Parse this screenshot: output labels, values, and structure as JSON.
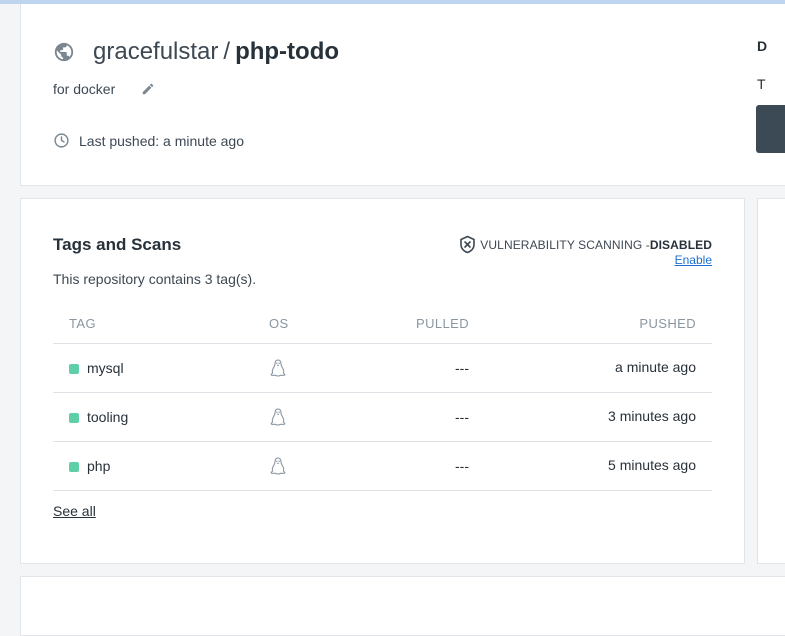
{
  "repo": {
    "namespace": "gracefulstar",
    "separator": "/",
    "name": "php-todo",
    "description": "for docker",
    "last_pushed": "Last pushed: a minute ago",
    "visibility_icon": "globe-icon"
  },
  "side_panel": {
    "heading_initial": "D",
    "text_initial": "T"
  },
  "tags": {
    "title": "Tags and Scans",
    "subtitle": "This repository contains 3 tag(s).",
    "vuln_label": "VULNERABILITY SCANNING - ",
    "vuln_status": "DISABLED",
    "enable_link": "Enable",
    "columns": {
      "tag": "TAG",
      "os": "OS",
      "pulled": "PULLED",
      "pushed": "PUSHED"
    },
    "rows": [
      {
        "tag": "mysql",
        "os": "linux-icon",
        "pulled": "---",
        "pushed": "a minute ago"
      },
      {
        "tag": "tooling",
        "os": "linux-icon",
        "pulled": "---",
        "pushed": "3 minutes ago"
      },
      {
        "tag": "php",
        "os": "linux-icon",
        "pulled": "---",
        "pushed": "5 minutes ago"
      }
    ],
    "see_all": "See all"
  },
  "colors": {
    "status_dot": "#5fcfa8",
    "link": "#1d6fd1",
    "side_button": "#3b4a54"
  }
}
